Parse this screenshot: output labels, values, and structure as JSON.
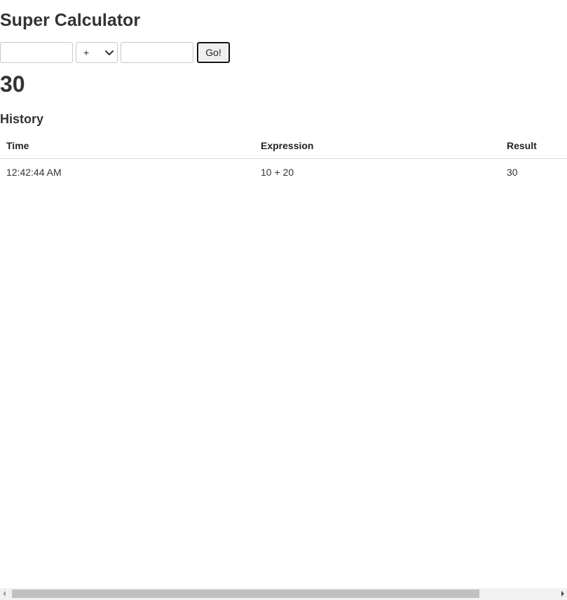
{
  "app": {
    "title": "Super Calculator"
  },
  "form": {
    "first_value": "",
    "operator": "+",
    "second_value": "",
    "go_label": "Go!"
  },
  "result": {
    "value": "30"
  },
  "history": {
    "heading": "History",
    "columns": [
      "Time",
      "Expression",
      "Result"
    ],
    "rows": [
      {
        "time": "12:42:44 AM",
        "expression": "10 + 20",
        "result": "30"
      }
    ]
  },
  "icons": {
    "select_arrow": "chevron-down-icon",
    "scroll_left": "scroll-left-arrow-icon",
    "scroll_right": "scroll-right-arrow-icon"
  }
}
